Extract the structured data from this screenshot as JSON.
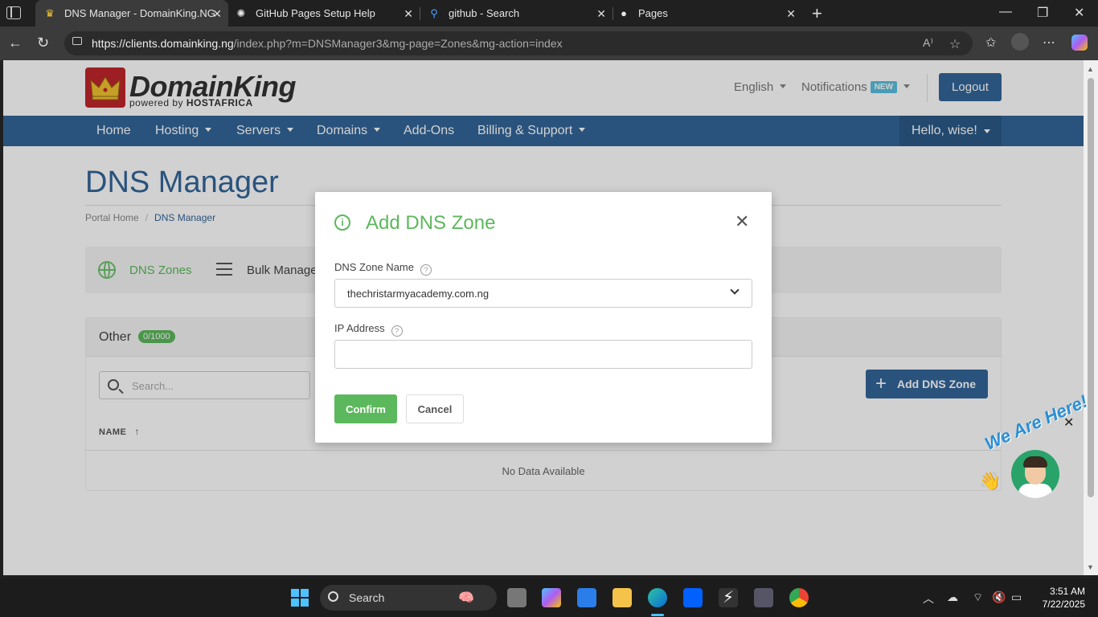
{
  "browser": {
    "tabs": [
      {
        "title": "DNS Manager - DomainKing.NG",
        "icon": "crown-icon",
        "active": true
      },
      {
        "title": "GitHub Pages Setup Help",
        "icon": "openai-icon",
        "active": false
      },
      {
        "title": "github - Search",
        "icon": "search-icon",
        "active": false
      },
      {
        "title": "Pages",
        "icon": "github-icon",
        "active": false
      }
    ],
    "url_host": "https://clients.domainking.ng",
    "url_path": "/index.php?m=DNSManager3&mg-page=Zones&mg-action=index"
  },
  "site": {
    "logo_name": "DomainKing",
    "logo_sub_prefix": "powered by ",
    "logo_sub_brand": "HOSTAFRICA",
    "language": "English",
    "notifications": "Notifications",
    "notifications_badge": "NEW",
    "logout": "Logout",
    "brand_color": "#336699",
    "accent_color": "#5cb85c"
  },
  "nav": {
    "home": "Home",
    "hosting": "Hosting",
    "servers": "Servers",
    "domains": "Domains",
    "addons": "Add-Ons",
    "billing": "Billing & Support",
    "hello": "Hello, wise!"
  },
  "page": {
    "title": "DNS Manager",
    "breadcrumb_home": "Portal Home",
    "breadcrumb_current": "DNS Manager",
    "tab_dns_zones": "DNS Zones",
    "tab_bulk": "Bulk Manage"
  },
  "panel": {
    "title": "Other",
    "count": "0/1000",
    "search_placeholder": "Search...",
    "add_button": "Add DNS Zone",
    "column_name": "NAME",
    "empty_text": "No Data Available"
  },
  "modal": {
    "title": "Add DNS Zone",
    "zone_label": "DNS Zone Name",
    "zone_value": "thechristarmyacademy.com.ng",
    "ip_label": "IP Address",
    "ip_value": "",
    "confirm": "Confirm",
    "cancel": "Cancel"
  },
  "chat": {
    "text": "We Are Here!"
  },
  "taskbar": {
    "search": "Search",
    "time": "3:51 AM",
    "date": "7/22/2025"
  }
}
